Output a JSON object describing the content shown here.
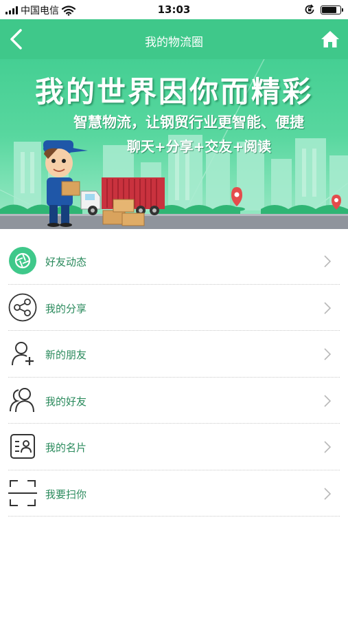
{
  "status_bar": {
    "carrier": "中国电信",
    "time": "13:03",
    "signal_bars": 4,
    "battery_level": 0.8,
    "icons": [
      "signal-icon",
      "wifi-icon",
      "orientation-lock-icon",
      "battery-icon"
    ]
  },
  "nav": {
    "title": "我的物流圈",
    "back_icon": "back-arrow-icon",
    "home_icon": "home-icon"
  },
  "banner": {
    "title": "我的世界因你而精彩",
    "subtitle_1": "智慧物流，让钢贸行业更智能、便捷",
    "subtitle_2": "聊天+分享+交友+阅读"
  },
  "menu": {
    "items": [
      {
        "label": "好友动态",
        "icon": "camera-shutter-icon"
      },
      {
        "label": "我的分享",
        "icon": "share-icon"
      },
      {
        "label": "新的朋友",
        "icon": "add-user-icon"
      },
      {
        "label": "我的好友",
        "icon": "friends-icon"
      },
      {
        "label": "我的名片",
        "icon": "business-card-icon"
      },
      {
        "label": "我要扫你",
        "icon": "scan-icon"
      }
    ]
  },
  "colors": {
    "accent": "#3fc88a",
    "label_text": "#2a8a5c",
    "divider": "#c8c8c8"
  }
}
